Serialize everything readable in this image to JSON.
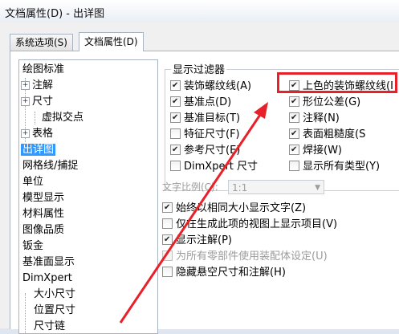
{
  "window": {
    "title": "文档属性(D) - 出详图"
  },
  "tabs": [
    {
      "label": "系统选项(S)",
      "active": false
    },
    {
      "label": "文档属性(D)",
      "active": true
    }
  ],
  "tree": {
    "items": [
      {
        "label": "绘图标准",
        "level": 0,
        "expander": ""
      },
      {
        "label": "注解",
        "level": 1,
        "expander": "+"
      },
      {
        "label": "尺寸",
        "level": 1,
        "expander": "+"
      },
      {
        "label": "虚拟交点",
        "level": 2,
        "expander": ""
      },
      {
        "label": "表格",
        "level": 1,
        "expander": "+"
      },
      {
        "label": "出详图",
        "level": 0,
        "expander": "",
        "selected": true
      },
      {
        "label": "网格线/捕捉",
        "level": 0,
        "expander": ""
      },
      {
        "label": "单位",
        "level": 0,
        "expander": ""
      },
      {
        "label": "模型显示",
        "level": 0,
        "expander": ""
      },
      {
        "label": "材料属性",
        "level": 0,
        "expander": ""
      },
      {
        "label": "图像品质",
        "level": 0,
        "expander": ""
      },
      {
        "label": "钣金",
        "level": 0,
        "expander": ""
      },
      {
        "label": "基准面显示",
        "level": 0,
        "expander": ""
      },
      {
        "label": "DimXpert",
        "level": 0,
        "expander": ""
      },
      {
        "label": "大小尺寸",
        "level": 1,
        "expander": ""
      },
      {
        "label": "位置尺寸",
        "level": 1,
        "expander": ""
      },
      {
        "label": "尺寸链",
        "level": 1,
        "expander": ""
      }
    ]
  },
  "filter": {
    "title": "显示过滤器",
    "left": [
      {
        "label": "装饰螺纹线(A)",
        "checked": true
      },
      {
        "label": "基准点(D)",
        "checked": true
      },
      {
        "label": "基准目标(T)",
        "checked": true
      },
      {
        "label": "特征尺寸(F)",
        "checked": false
      },
      {
        "label": "参考尺寸(E)",
        "checked": true
      },
      {
        "label": "DimXpert 尺寸",
        "checked": false
      }
    ],
    "right": [
      {
        "label": "上色的装饰螺纹线(I",
        "checked": true
      },
      {
        "label": "形位公差(G)",
        "checked": true
      },
      {
        "label": "注释(N)",
        "checked": true
      },
      {
        "label": "表面粗糙度(S",
        "checked": true
      },
      {
        "label": "焊接(W)",
        "checked": true
      },
      {
        "label": "显示所有类型(Y)",
        "checked": false
      }
    ]
  },
  "text_scale": {
    "label": "文字比例(C):",
    "value": "1:1"
  },
  "options": [
    {
      "label": "始终以相同大小显示文字(Z)",
      "checked": true,
      "disabled": false
    },
    {
      "label": "仅在生成此项的视图上显示项目(V)",
      "checked": false,
      "disabled": false
    },
    {
      "label": "显示注解(P)",
      "checked": true,
      "disabled": false
    },
    {
      "label": "为所有零部件使用装配体设定(U)",
      "checked": false,
      "disabled": true
    },
    {
      "label": "隐藏悬空尺寸和注解(H)",
      "checked": false,
      "disabled": false
    }
  ],
  "colors": {
    "highlight": "#e8202a",
    "selection": "#3399ff"
  }
}
